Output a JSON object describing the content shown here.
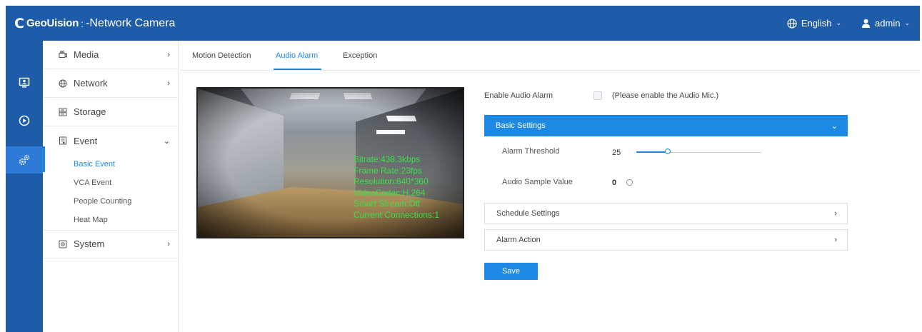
{
  "header": {
    "brand_mark": "C",
    "brand": "GeoUision",
    "separator": ":",
    "product": "-Network Camera",
    "language": "English",
    "user": "admin"
  },
  "rail": {
    "items": [
      {
        "name": "live-view",
        "icon": "monitor-icon",
        "active": false
      },
      {
        "name": "playback",
        "icon": "play-circle-icon",
        "active": false
      },
      {
        "name": "settings",
        "icon": "gears-icon",
        "active": true
      }
    ]
  },
  "nav": {
    "items": [
      {
        "label": "Media",
        "icon": "camera-icon",
        "expanded": false
      },
      {
        "label": "Network",
        "icon": "globe-icon",
        "expanded": false
      },
      {
        "label": "Storage",
        "icon": "storage-icon",
        "expanded": null
      },
      {
        "label": "Event",
        "icon": "event-icon",
        "expanded": true
      },
      {
        "label": "System",
        "icon": "system-icon",
        "expanded": false
      }
    ],
    "event_sub": [
      "Basic Event",
      "VCA Event",
      "People Counting",
      "Heat Map"
    ],
    "active_sub": "Basic Event"
  },
  "tabs": [
    "Motion Detection",
    "Audio Alarm",
    "Exception"
  ],
  "active_tab": "Audio Alarm",
  "video": {
    "osd": [
      "Bitrate:438.3kbps",
      "Frame Rate:23fps",
      "Resolution:640*360",
      "VideoCodec:H.264",
      "Smart Stream:Off",
      "Current Connections:1"
    ]
  },
  "audio_alarm": {
    "enable_label": "Enable Audio Alarm",
    "enabled": false,
    "enable_hint": "(Please enable the Audio Mic.)",
    "basic_settings": "Basic Settings",
    "threshold_label": "Alarm Threshold",
    "threshold_value": "25",
    "threshold_fraction": 0.25,
    "sample_label": "Audio Sample Value",
    "sample_value": "0",
    "schedule_settings": "Schedule Settings",
    "alarm_action": "Alarm Action",
    "save": "Save"
  },
  "colors": {
    "header": "#1e5ba8",
    "accent": "#1e88e5",
    "osd_text": "#38e04a"
  }
}
